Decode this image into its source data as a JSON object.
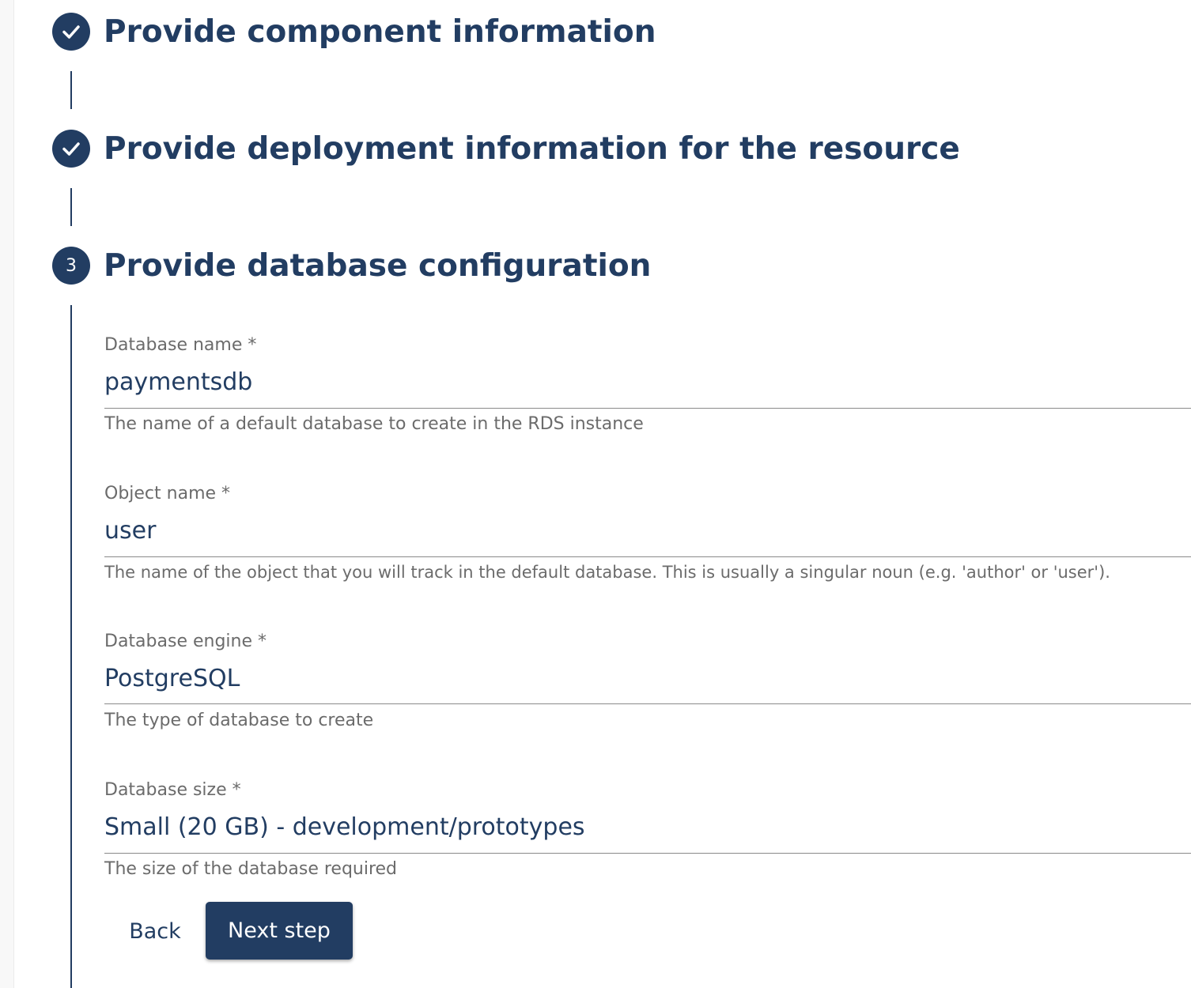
{
  "steps": [
    {
      "title": "Provide component information",
      "status": "completed",
      "icon": "check-icon"
    },
    {
      "title": "Provide deployment information for the resource",
      "status": "completed",
      "icon": "check-icon"
    },
    {
      "title": "Provide database configuration",
      "status": "active",
      "number": "3"
    }
  ],
  "fields": {
    "database_name": {
      "label": "Database name *",
      "value": "paymentsdb",
      "helper": "The name of a default database to create in the RDS instance"
    },
    "object_name": {
      "label": "Object name *",
      "value": "user",
      "helper": "The name of the object that you will track in the default database. This is usually a singular noun (e.g. 'author' or 'user')."
    },
    "database_engine": {
      "label": "Database engine *",
      "value": "PostgreSQL",
      "helper": "The type of database to create"
    },
    "database_size": {
      "label": "Database size *",
      "value": "Small (20 GB) - development/prototypes",
      "helper": "The size of the database required"
    }
  },
  "actions": {
    "back_label": "Back",
    "next_label": "Next step"
  },
  "colors": {
    "primary": "#223d62",
    "label": "#6b6b6b",
    "background": "#ffffff"
  }
}
